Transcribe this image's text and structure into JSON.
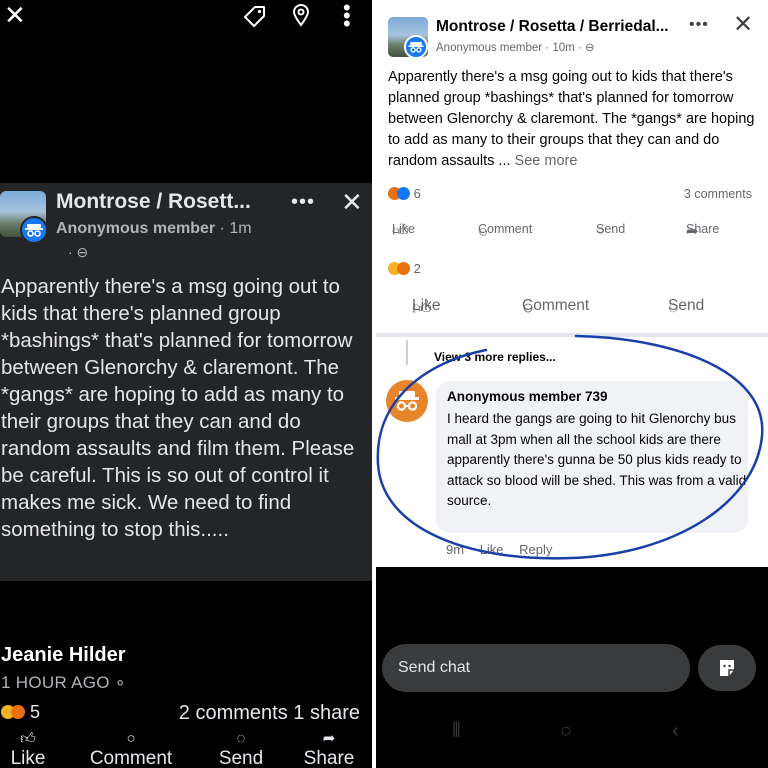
{
  "left": {
    "post": {
      "group": "Montrose / Rosett...",
      "more": "•••",
      "member": "Anonymous member",
      "time": "· 1m",
      "body": "Apparently there's a msg going out to kids that there's planned group *bashings* that's planned for tomorrow between Glenorchy & claremont. The *gangs* are hoping to add as many to their groups that they can and do random assaults and film them. Please be careful. This is so out of control it makes me sick. We need to find something to stop this....."
    },
    "author": "Jeanie Hilder",
    "ago": "1 HOUR AGO",
    "reaction_count": "5",
    "comments": "2 comments",
    "shares": "1 share",
    "actions": {
      "like": "Like",
      "comment": "Comment",
      "send": "Send",
      "share": "Share"
    }
  },
  "right": {
    "post": {
      "group": "Montrose / Rosetta / Berriedal...",
      "member": "Anonymous member · 10m ·",
      "body": "Apparently there's a msg going out to kids that there's planned group *bashings* that's planned for tomorrow between Glenorchy & claremont. The *gangs* are hoping to add as many to their groups that they can and do random assaults ...",
      "see_more": "See more",
      "reaction_count": "6",
      "comments": "3 comments"
    },
    "actions1": {
      "like": "Like",
      "comment": "Comment",
      "send": "Send",
      "share": "Share"
    },
    "reaction_count2": "2",
    "actions2": {
      "like": "Like",
      "comment": "Comment",
      "send": "Send"
    },
    "view_more": "View 3 more replies...",
    "comment": {
      "author": "Anonymous member 739",
      "text": "I heard the gangs are going to hit Glenorchy bus mall at 3pm when all the school kids are there apparently there's gunna be 50 plus kids ready to attack so blood will be shed. This was from a valid source.",
      "time": "9m",
      "like": "Like",
      "reply": "Reply"
    },
    "chat_placeholder": "Send chat"
  },
  "colors": {
    "annotation": "#1a3fa8",
    "facebook_blue": "#1877f2",
    "anon_avatar": "#e8852b"
  }
}
